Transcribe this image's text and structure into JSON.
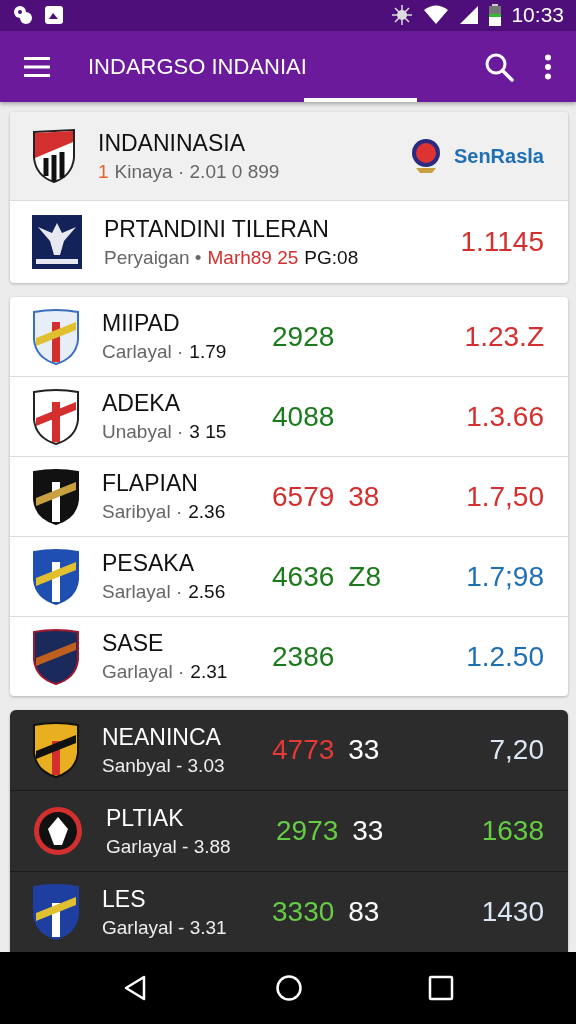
{
  "status_bar": {
    "time": "10:33"
  },
  "app_bar": {
    "title": "INDARGSO INDANIAI"
  },
  "featured": {
    "team": "INDANINASIA",
    "rank": "1",
    "subtitle": "Kinaya · 2.01 0 899",
    "partner": "SenRasla",
    "match": {
      "title": "PRTANDINI TILERAN",
      "label": "Peryaigan •",
      "date": "Marh89 25",
      "time": "PG:08",
      "odds": {
        "text": "1.1145",
        "color": "#d32f2f"
      }
    }
  },
  "teams": [
    {
      "name": "MIIPAD",
      "label": "Carlayal ·",
      "value": "1.79",
      "score": {
        "text": "2928",
        "color": "#1b7a1b"
      },
      "odds": {
        "text": "1.23.Z",
        "color": "#d32f2f"
      }
    },
    {
      "name": "ADEKA",
      "label": "Unabyal ·",
      "value": "3 15",
      "score": {
        "text": "4088",
        "color": "#1b7a1b"
      },
      "odds": {
        "text": "1.3.66",
        "color": "#d32f2f"
      }
    },
    {
      "name": "FLAPIAN",
      "label": "Saribyal ·",
      "value": "2.36",
      "score": {
        "text": "6579",
        "color": "#d32f2f"
      },
      "extra": "38",
      "odds": {
        "text": "1.7,50",
        "color": "#d32f2f"
      }
    },
    {
      "name": "PESAKA",
      "label": "Sarlayal ·",
      "value": "2.56",
      "score": {
        "text": "4636",
        "color": "#1b7a1b"
      },
      "extra": "Z8",
      "odds": {
        "text": "1.7;98",
        "color": "#1f6fb5"
      }
    },
    {
      "name": "SASE",
      "label": "Garlayal ·",
      "value": "2.31",
      "score": {
        "text": "2386",
        "color": "#1b7a1b"
      },
      "odds": {
        "text": "1.2.50",
        "color": "#1f6fb5"
      }
    }
  ],
  "dark_teams": [
    {
      "name": "NEANINCA",
      "subtitle": "Sanbyal - 3.03",
      "score": {
        "text": "4773",
        "color": "#e53935"
      },
      "extra": "33",
      "odds": {
        "text": "7,20",
        "color": "#dce6f5"
      }
    },
    {
      "name": "PLTIAK",
      "subtitle": "Garlayal - 3.88",
      "score": {
        "text": "2973",
        "color": "#66cc44"
      },
      "extra": "33",
      "odds": {
        "text": "1638",
        "color": "#66cc44"
      }
    },
    {
      "name": "LES",
      "subtitle": "Garlayal - 3.31",
      "score": {
        "text": "3330",
        "color": "#66cc44"
      },
      "extra": "83",
      "odds": {
        "text": "1430",
        "color": "#dce6f5"
      }
    }
  ]
}
